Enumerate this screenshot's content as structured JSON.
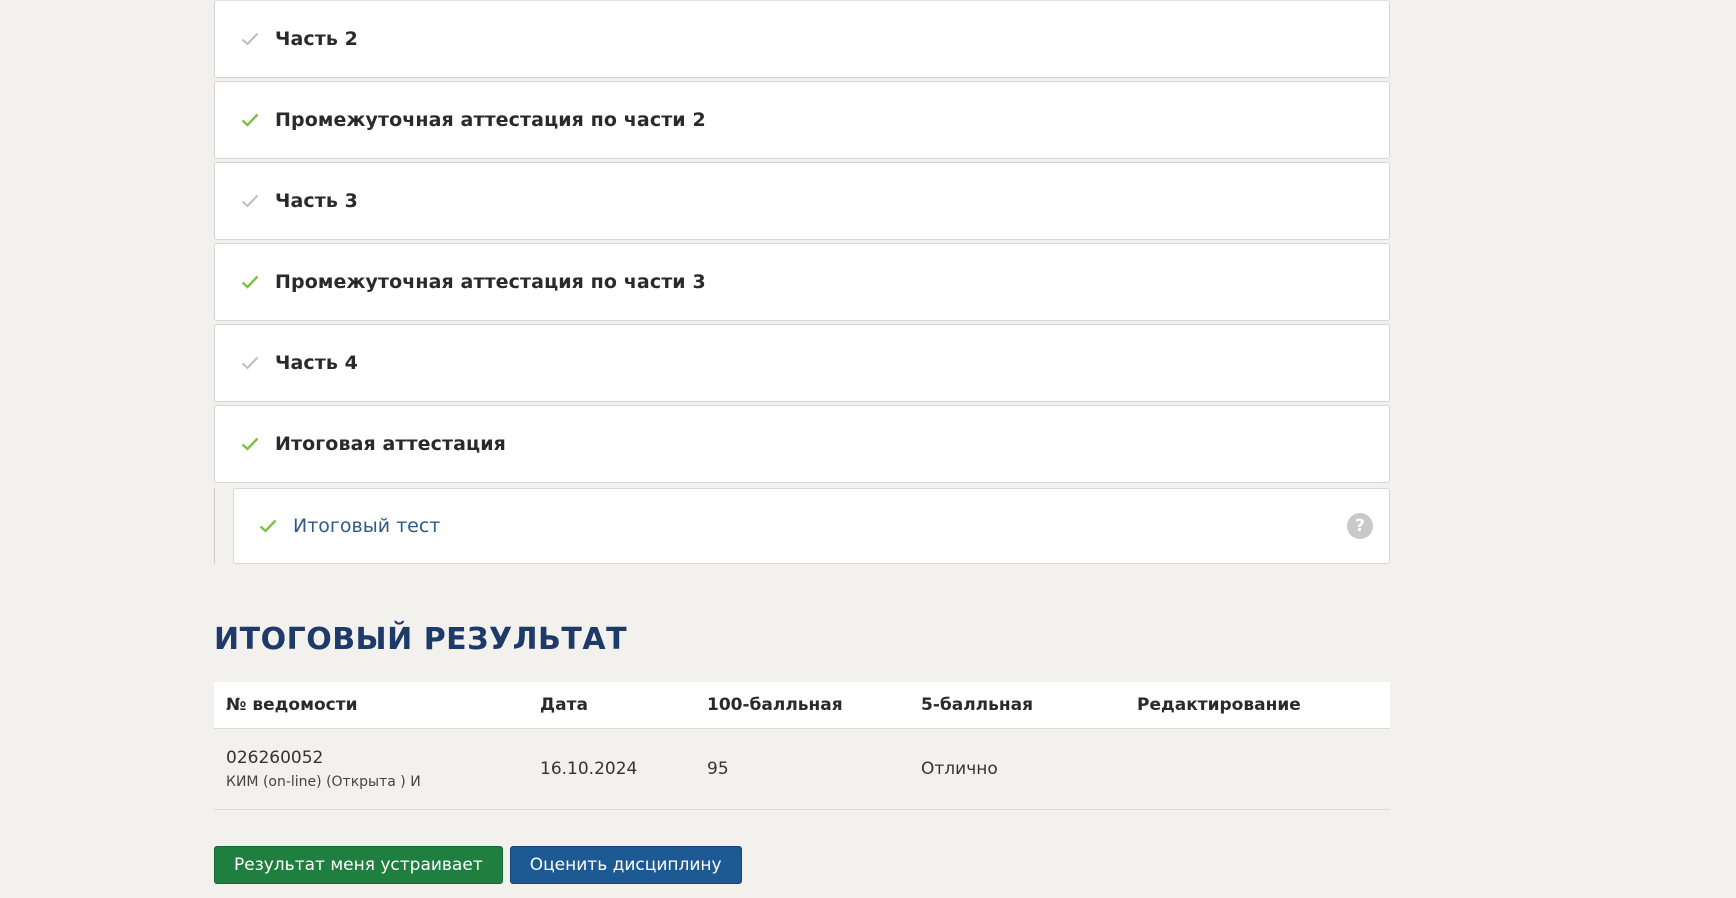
{
  "sections": [
    {
      "title": "Часть 2",
      "status": "gray"
    },
    {
      "title": "Промежуточная аттестация по части 2",
      "status": "green"
    },
    {
      "title": "Часть 3",
      "status": "gray"
    },
    {
      "title": "Промежуточная аттестация по части 3",
      "status": "green"
    },
    {
      "title": "Часть 4",
      "status": "gray"
    },
    {
      "title": "Итоговая аттестация",
      "status": "green"
    }
  ],
  "subsection": {
    "title": "Итоговый тест",
    "status": "green",
    "help_icon": "question-circle-icon",
    "help_symbol": "?"
  },
  "result": {
    "heading": "ИТОГОВЫЙ РЕЗУЛЬТАТ",
    "columns": [
      "№ ведомости",
      "Дата",
      "100-балльная",
      "5-балльная",
      "Редактирование"
    ],
    "rows": [
      {
        "number": "026260052",
        "number_sub": "КИМ (on-line) (Открыта ) И",
        "date": "16.10.2024",
        "score100": "95",
        "score5": "Отлично",
        "edit": ""
      }
    ]
  },
  "buttons": {
    "accept": "Результат меня устраивает",
    "rate": "Оценить дисциплину"
  },
  "colors": {
    "check_green": "#7ac143",
    "check_gray": "#bdbdbd",
    "heading": "#1d3a68",
    "link": "#2e5b87",
    "btn_green": "#1f7f3f",
    "btn_blue": "#1d5a93",
    "background": "#f2f1ee"
  }
}
